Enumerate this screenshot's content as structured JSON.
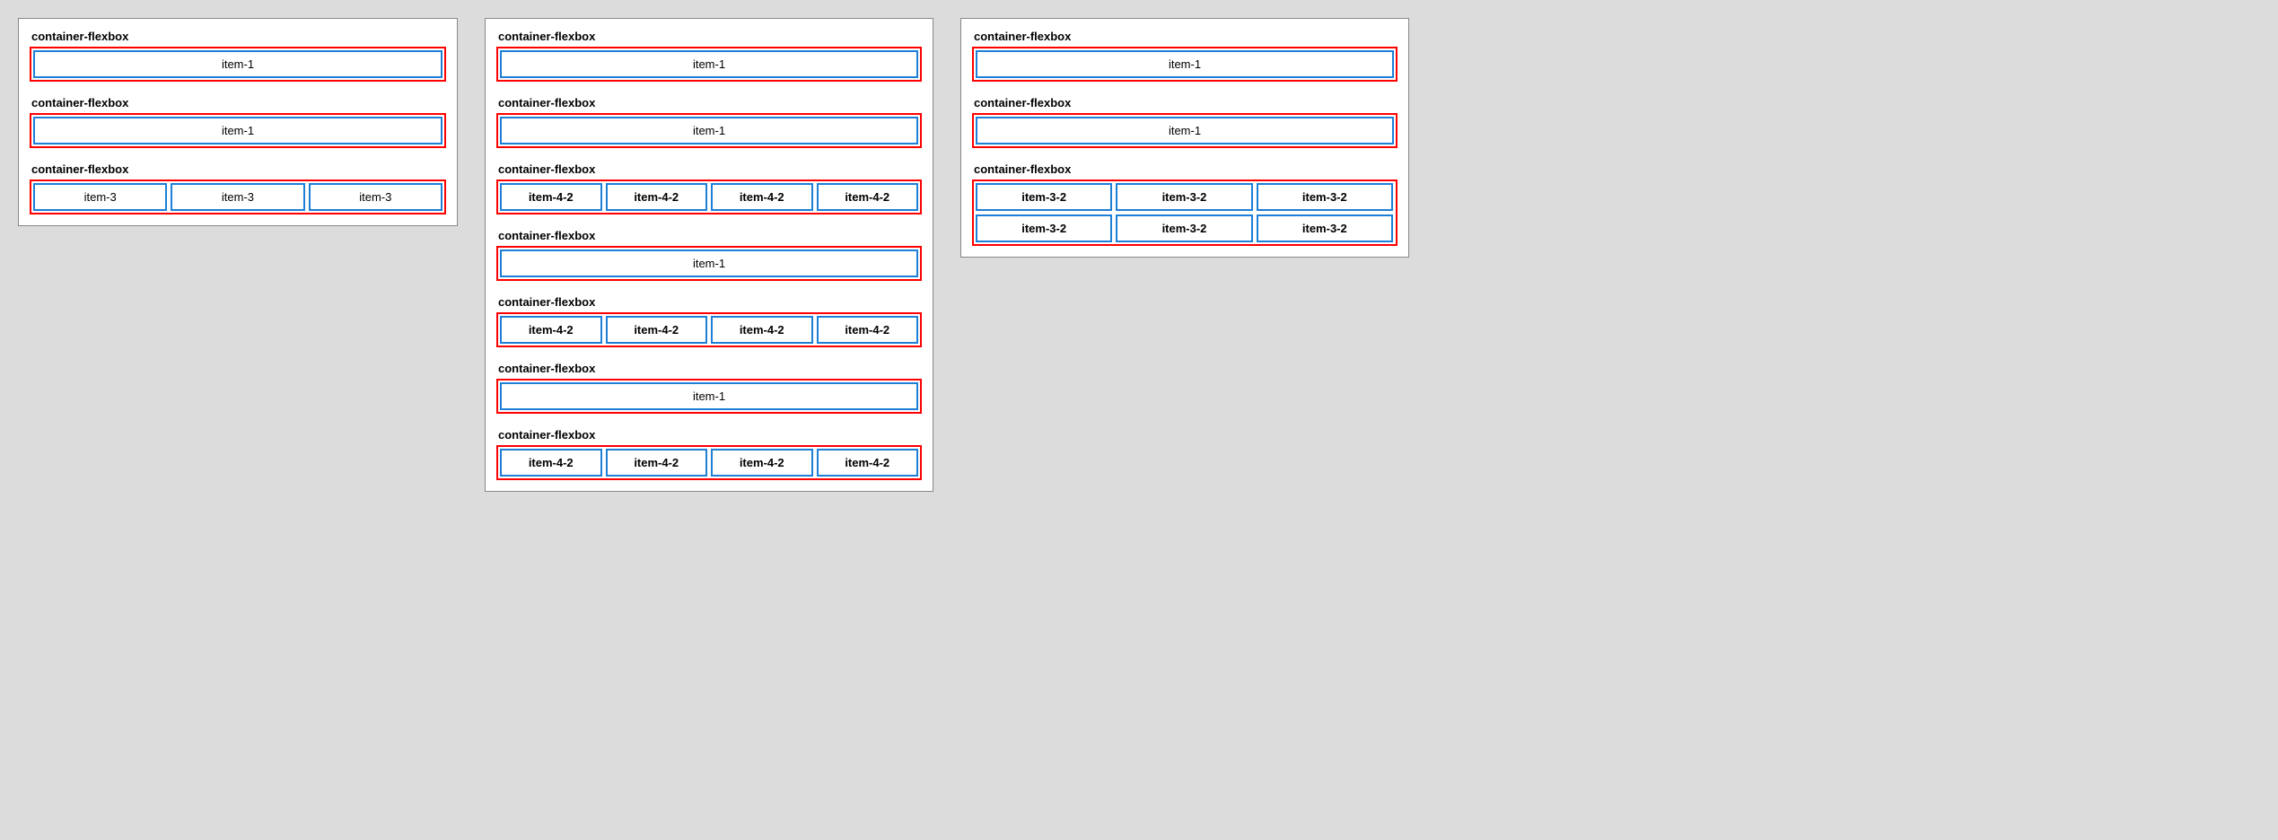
{
  "panel1": {
    "groups": [
      {
        "label": "container-flexbox",
        "items": [
          {
            "text": "item-1",
            "cls": "item-full"
          }
        ]
      },
      {
        "label": "container-flexbox",
        "items": [
          {
            "text": "item-1",
            "cls": "item-full"
          }
        ]
      },
      {
        "label": "container-flexbox",
        "items": [
          {
            "text": "item-3",
            "cls": "item-third"
          },
          {
            "text": "item-3",
            "cls": "item-third"
          },
          {
            "text": "item-3",
            "cls": "item-third"
          }
        ]
      }
    ]
  },
  "panel2": {
    "groups": [
      {
        "label": "container-flexbox",
        "items": [
          {
            "text": "item-1",
            "cls": "item-full"
          }
        ]
      },
      {
        "label": "container-flexbox",
        "items": [
          {
            "text": "item-1",
            "cls": "item-full"
          }
        ]
      },
      {
        "label": "container-flexbox",
        "items": [
          {
            "text": "item-4-2",
            "cls": "item-quarter"
          },
          {
            "text": "item-4-2",
            "cls": "item-quarter"
          },
          {
            "text": "item-4-2",
            "cls": "item-quarter"
          },
          {
            "text": "item-4-2",
            "cls": "item-quarter"
          }
        ]
      },
      {
        "label": "container-flexbox",
        "items": [
          {
            "text": "item-1",
            "cls": "item-full"
          }
        ]
      },
      {
        "label": "container-flexbox",
        "items": [
          {
            "text": "item-4-2",
            "cls": "item-quarter"
          },
          {
            "text": "item-4-2",
            "cls": "item-quarter"
          },
          {
            "text": "item-4-2",
            "cls": "item-quarter"
          },
          {
            "text": "item-4-2",
            "cls": "item-quarter"
          }
        ]
      },
      {
        "label": "container-flexbox",
        "items": [
          {
            "text": "item-1",
            "cls": "item-full"
          }
        ]
      },
      {
        "label": "container-flexbox",
        "items": [
          {
            "text": "item-4-2",
            "cls": "item-quarter"
          },
          {
            "text": "item-4-2",
            "cls": "item-quarter"
          },
          {
            "text": "item-4-2",
            "cls": "item-quarter"
          },
          {
            "text": "item-4-2",
            "cls": "item-quarter"
          }
        ]
      }
    ]
  },
  "panel3": {
    "groups": [
      {
        "label": "container-flexbox",
        "items": [
          {
            "text": "item-1",
            "cls": "item-full"
          }
        ]
      },
      {
        "label": "container-flexbox",
        "items": [
          {
            "text": "item-1",
            "cls": "item-full"
          }
        ]
      },
      {
        "label": "container-flexbox",
        "items": [
          {
            "text": "item-3-2",
            "cls": "item-third-2row"
          },
          {
            "text": "item-3-2",
            "cls": "item-third-2row"
          },
          {
            "text": "item-3-2",
            "cls": "item-third-2row"
          },
          {
            "text": "item-3-2",
            "cls": "item-third-2row"
          },
          {
            "text": "item-3-2",
            "cls": "item-third-2row"
          },
          {
            "text": "item-3-2",
            "cls": "item-third-2row"
          }
        ]
      }
    ]
  }
}
